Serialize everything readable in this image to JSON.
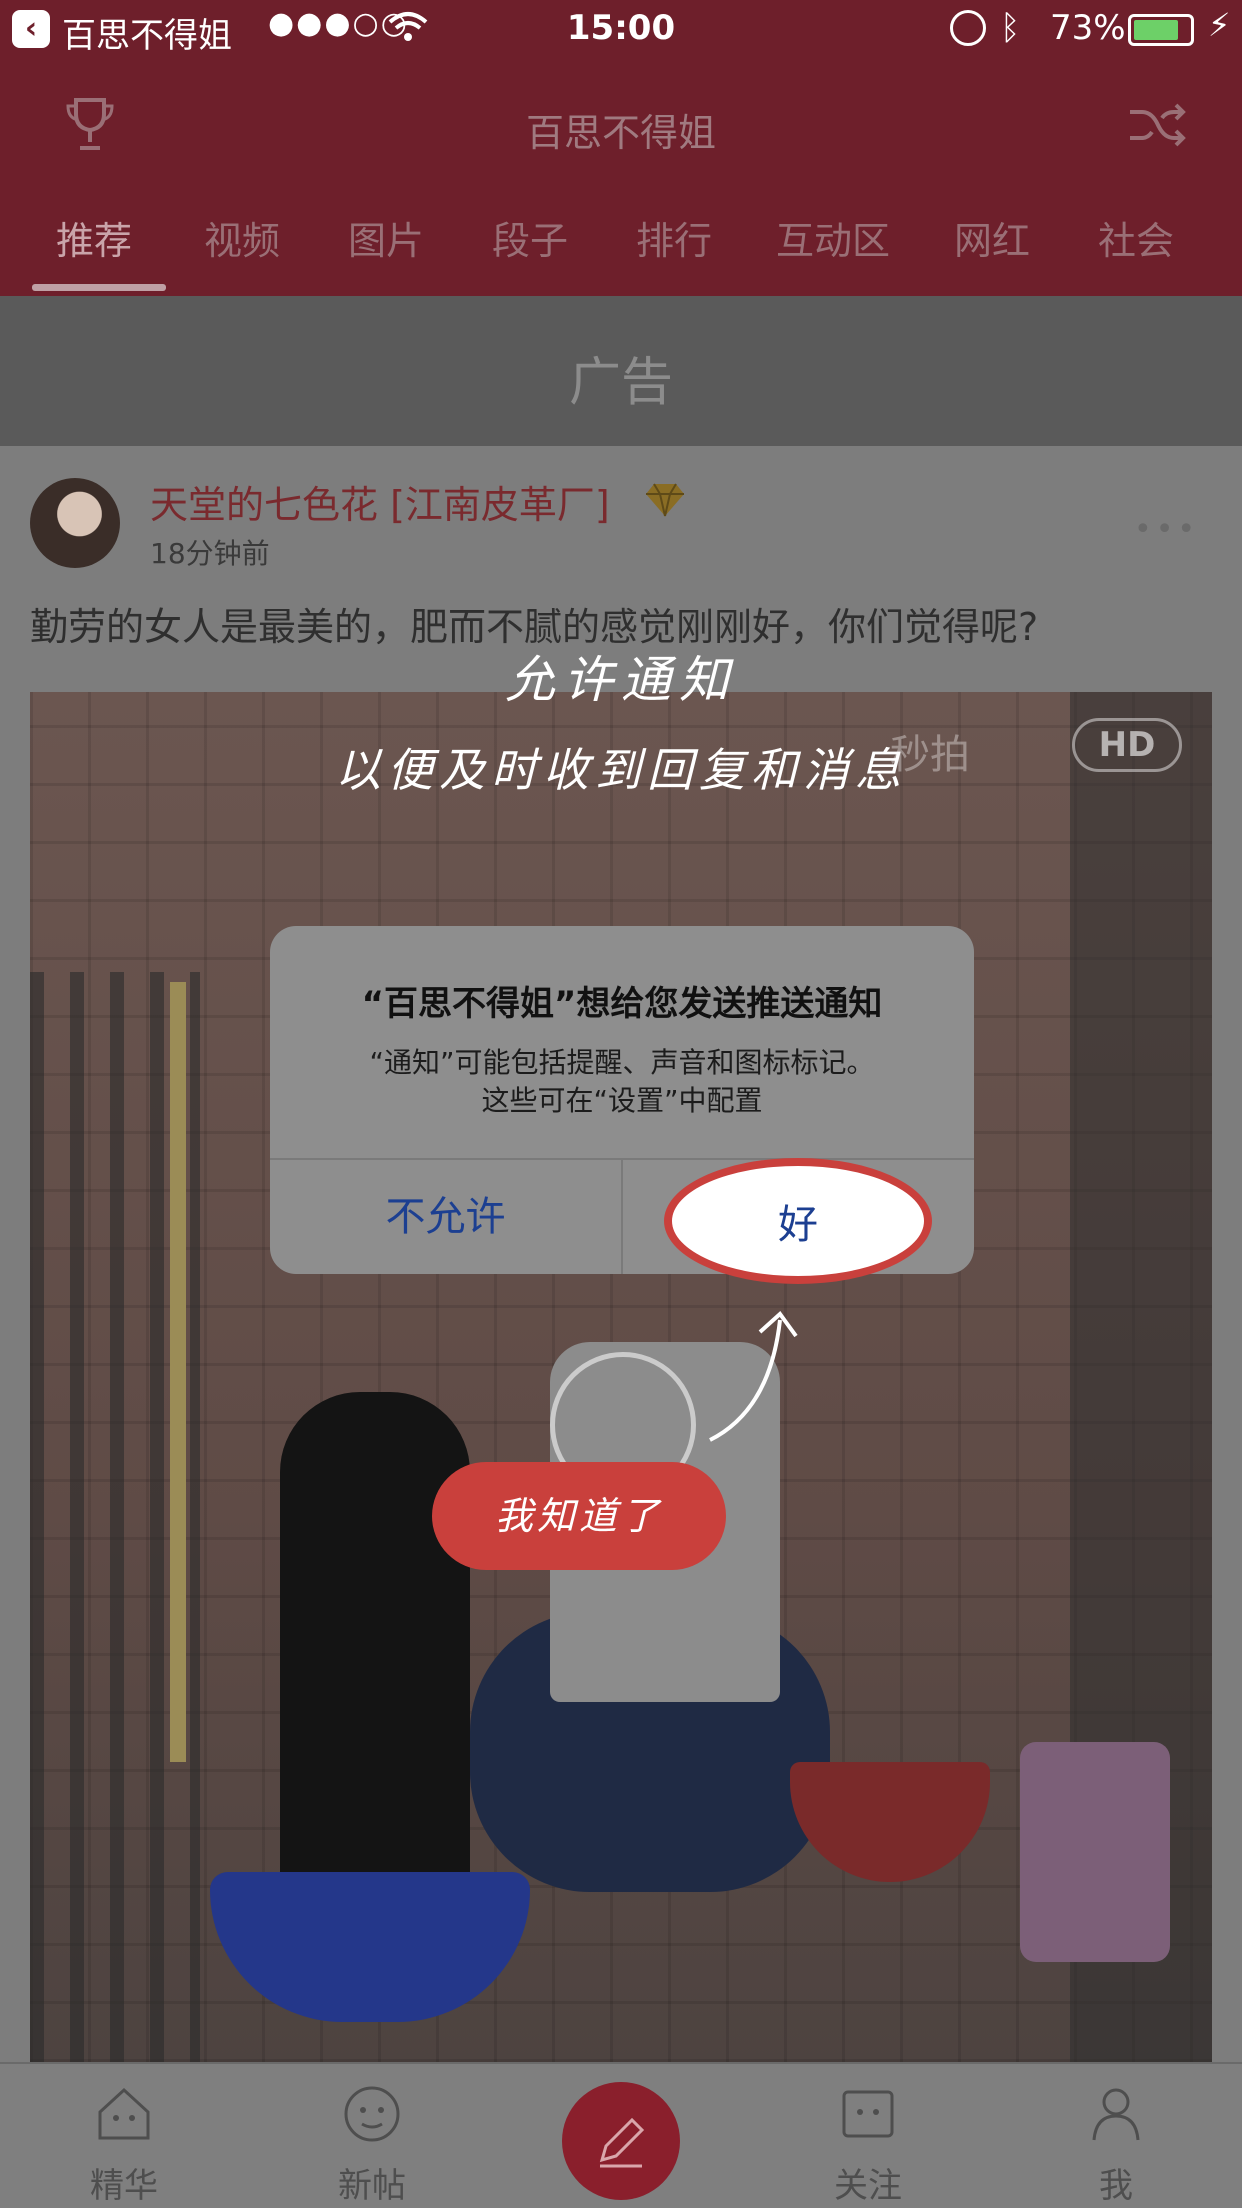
{
  "status_bar": {
    "back_app": "百思不得姐",
    "signal": "●●●○○",
    "time": "15:00",
    "battery_pct": "73%",
    "battery_level": 0.73
  },
  "header": {
    "title": "百思不得姐",
    "tabs": [
      "推荐",
      "视频",
      "图片",
      "段子",
      "排行",
      "互动区",
      "网红",
      "社会"
    ]
  },
  "ad": {
    "label": "广告"
  },
  "post": {
    "author": "天堂的七色花 [江南皮革厂]",
    "time_ago": "18分钟前",
    "more": "•••",
    "caption": "勤劳的女人是最美的，肥而不腻的感觉刚刚好，你们觉得呢?",
    "watermark": "秒拍",
    "hd": "HD"
  },
  "overlay": {
    "title": "允许通知",
    "subtitle": "以便及时收到回复和消息",
    "got_it": "我知道了"
  },
  "alert": {
    "title": "“百思不得姐”想给您发送推送通知",
    "message_line1": "“通知”可能包括提醒、声音和图标标记。",
    "message_line2": "这些可在“设置”中配置",
    "deny": "不允许",
    "allow": "好"
  },
  "tabbar": {
    "items": [
      "精华",
      "新帖",
      "关注",
      "我"
    ]
  },
  "colors": {
    "brand": "#6e1f2b",
    "accent_red": "#c9403c",
    "ios_blue": "#1c3f91"
  }
}
